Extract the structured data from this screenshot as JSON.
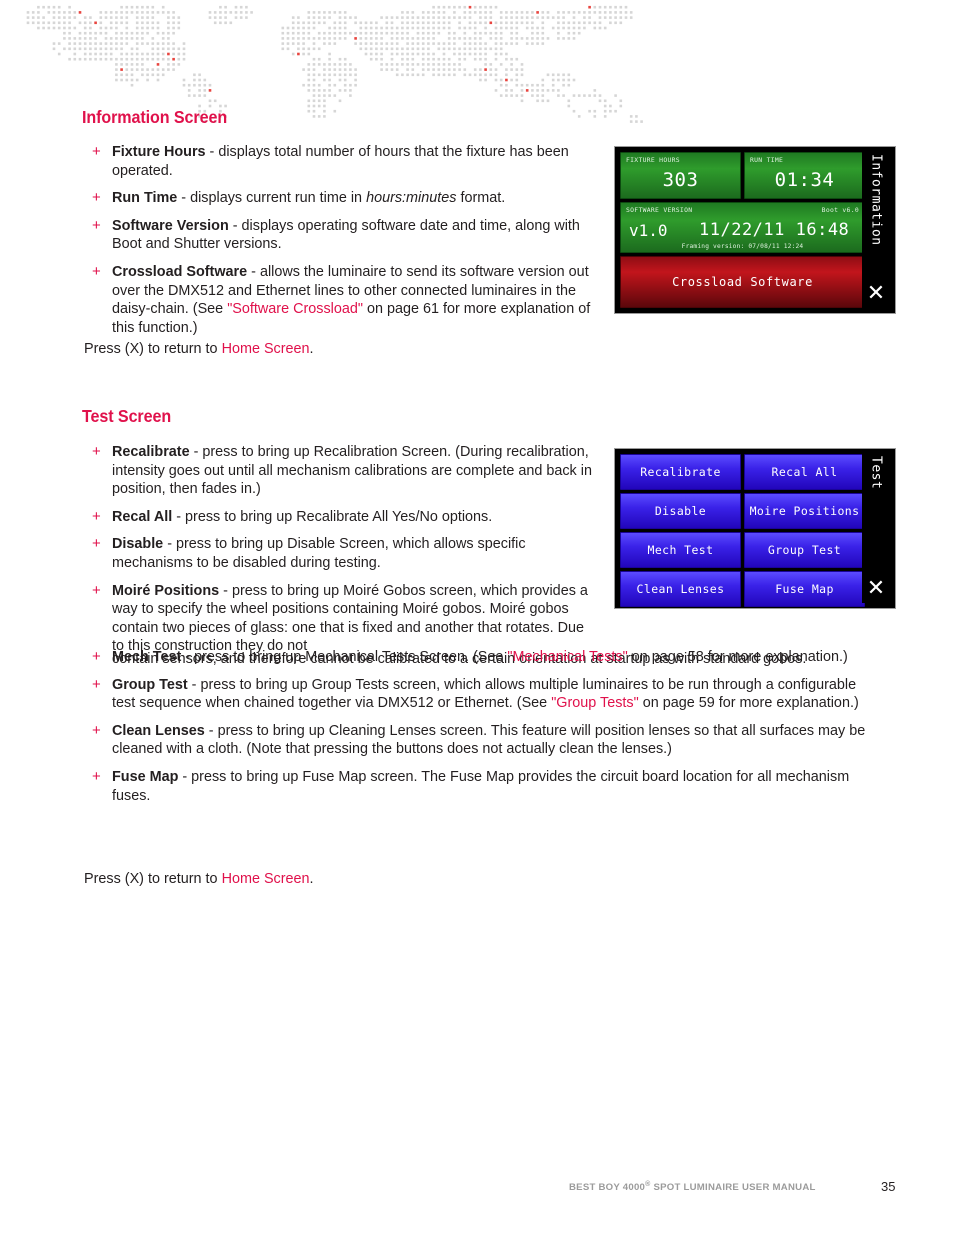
{
  "footer": {
    "manual_title_pre": "BEST BOY 4000",
    "manual_title_sup": "®",
    "manual_title_post": " SPOT LUMINAIRE USER MANUAL",
    "page_number": "35"
  },
  "sections": [
    {
      "heading": "Information Screen",
      "press_line_pre": "Press (X) to return to ",
      "press_line_link": "Home Screen",
      "press_line_post": "."
    },
    {
      "heading": "Test Screen",
      "press_line_pre": "Press (X) to return to ",
      "press_line_link": "Home Screen",
      "press_line_post": "."
    }
  ],
  "information_bullets": [
    {
      "term": "Fixture Hours",
      "text": " - displays total number of hours that the fixture has been operated."
    },
    {
      "term": "Run Time",
      "text_a": " - displays current run time in ",
      "italic": "hours:minutes",
      "text_b": " format."
    },
    {
      "term": "Software Version",
      "text": " - displays operating software date and time, along with Boot and Shutter versions."
    },
    {
      "term": "Crossload Software",
      "text_a": " - allows the luminaire to send its software version out over the DMX512 and Ethernet lines to other connected luminaires in the daisy-chain. (See ",
      "link": "\"Software Crossload\"",
      "text_b": " on page 61 for more explanation of this function.)"
    }
  ],
  "test_bullets_narrow": [
    {
      "term": "Recalibrate",
      "text": " - press to bring up Recalibration Screen. (During recalibration, intensity goes out until all mechanism calibrations are complete and back in position, then fades in.)"
    },
    {
      "term": "Recal All",
      "text": " - press to bring up Recalibrate All Yes/No options."
    },
    {
      "term": "Disable",
      "text": " - press to bring up Disable Screen, which allows specific mechanisms to be disabled during testing."
    },
    {
      "term": "Moiré Positions",
      "text": " - press to bring up Moiré Gobos screen, which provides a way to specify the wheel positions containing Moiré gobos. Moiré gobos contain two pieces of glass: one that is fixed and another that rotates. Due to this construction they do not"
    }
  ],
  "test_moire_overflow": "contain sensors, and therefore cannot be calibrated to a certain orientation at startup as with standard gobos.",
  "test_bullets_wide": [
    {
      "term": "Mech Test",
      "text_a": " - press to bring up Mechanical Tests Screen. (See ",
      "link": "\"Mechanical Tests\"",
      "text_b": " on page 58 for more explanation.)"
    },
    {
      "term": "Group Test",
      "text_a": " - press to bring up Group Tests screen, which allows multiple luminaires to be run through a configurable test sequence when chained together via DMX512 or Ethernet. (See ",
      "link": "\"Group Tests\"",
      "text_b": " on page 59 for more explanation.)"
    },
    {
      "term": "Clean Lenses",
      "text": " - press to bring up Cleaning Lenses screen. This feature will position lenses so that all surfaces may be cleaned with a cloth. (Note that pressing the buttons does not actually clean the lenses.)"
    },
    {
      "term": "Fuse Map",
      "text": " - press to bring up Fuse Map screen. The Fuse Map provides the circuit board location for all mechanism fuses."
    }
  ],
  "information_screen": {
    "sidebar_label": "Information",
    "close_icon": "✕",
    "fixture_hours": {
      "caption": "FIXTURE HOURS",
      "value": "303"
    },
    "run_time": {
      "caption": "RUN TIME",
      "value": "01:34"
    },
    "software_version": {
      "caption": "SOFTWARE VERSION",
      "caption_right": "Boot v6.0",
      "version": "v1.0",
      "datetime": "11/22/11 16:48",
      "subnote": "Framing version: 07/08/11 12:24"
    },
    "crossload": {
      "label": "Crossload Software"
    }
  },
  "test_screen": {
    "sidebar_label": "Test",
    "close_icon": "✕",
    "buttons": [
      "Recalibrate",
      "Recal All",
      "Disable",
      "Moire Positions",
      "Mech Test",
      "Group Test",
      "Clean Lenses",
      "Fuse Map"
    ]
  },
  "colors": {
    "accent": "#e0114b",
    "text": "#231f20",
    "map_dot": "#d6d6d6",
    "map_dot_red": "#e8453f",
    "green_btn": "#2f9c2c",
    "red_btn": "#c2151c",
    "blue_btn": "#3a22e8"
  }
}
